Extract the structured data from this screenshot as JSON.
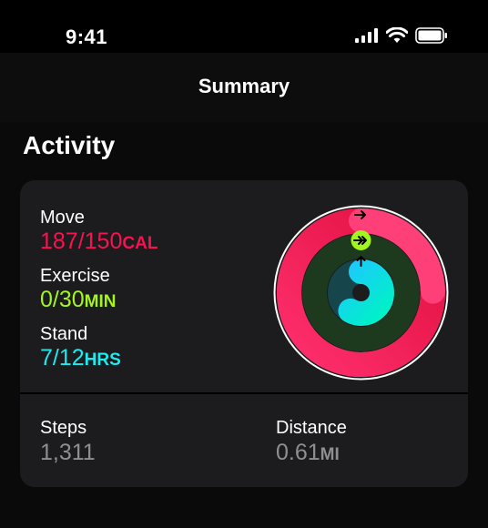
{
  "status_bar": {
    "time": "9:41",
    "icons": [
      "cellular-signal-icon",
      "wifi-icon",
      "battery-icon"
    ]
  },
  "nav": {
    "title": "Summary"
  },
  "activity": {
    "title": "Activity",
    "metrics": [
      {
        "label": "Move",
        "value": "187/150",
        "unit": "CAL",
        "color": "#fa114f",
        "progress": 1.247
      },
      {
        "label": "Exercise",
        "value": "0/30",
        "unit": "MIN",
        "color": "#a2f51e",
        "progress": 0.0
      },
      {
        "label": "Stand",
        "value": "7/12",
        "unit": "HRS",
        "color": "#1eeaef",
        "progress": 0.583
      }
    ],
    "steps": {
      "label": "Steps",
      "value": "1,311"
    },
    "distance": {
      "label": "Distance",
      "value": "0.61",
      "unit": "MI"
    }
  },
  "colors": {
    "move": "#fa114f",
    "exercise": "#a2f51e",
    "stand": "#1eeaef",
    "card_background": "#1c1c1e",
    "secondary_text": "#8e8e93"
  }
}
